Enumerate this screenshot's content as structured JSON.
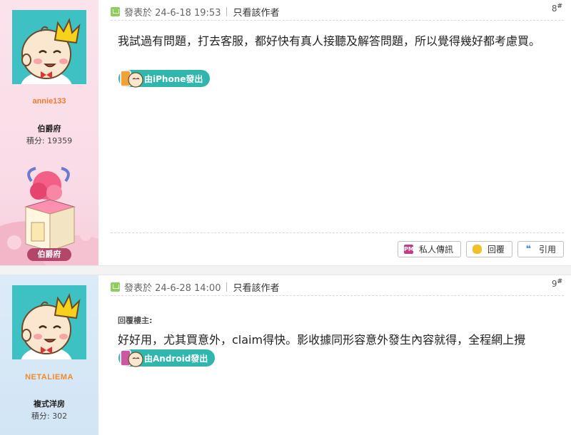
{
  "posts": [
    {
      "username": "annie133",
      "rank": "伯爵府",
      "points_label": "積分: 19359",
      "badge_label": "伯爵府",
      "meta_posted": "發表於 24-6-18 19:53",
      "meta_only_author": "只看該作者",
      "floor": "8",
      "floor_mark": "#",
      "body": "我試過有問題，打去客服，都好快有真人接聽及解答問題，所以覺得幾好都考慮買。",
      "device": "由iPhone發出",
      "actions": {
        "pm": "私人傳訊",
        "reply": "回覆",
        "quote": "引用"
      },
      "colors": {
        "sidebar": "#fbe3ec",
        "username": "#f07a2a",
        "device_pill": "#30b7ad"
      }
    },
    {
      "username": "NETALIEMA",
      "rank": "複式洋房",
      "points_label": "積分: 302",
      "meta_posted": "發表於 24-6-28 14:00",
      "meta_only_author": "只看該作者",
      "floor": "9",
      "floor_mark": "#",
      "quote_label": "回覆樓主:",
      "body": "好好用，尤其買意外，claim得快。影收據同形容意外發生內容就得，全程網上攪",
      "device": "由Android發出",
      "colors": {
        "sidebar": "#dcebf8",
        "username": "#f08a2a",
        "device_pill": "#30b7ad"
      }
    }
  ],
  "icons": [
    "post-doc-icon",
    "pm-icon",
    "reply-icon",
    "quote-icon",
    "baby-crown-avatar",
    "gift-box-badge"
  ]
}
